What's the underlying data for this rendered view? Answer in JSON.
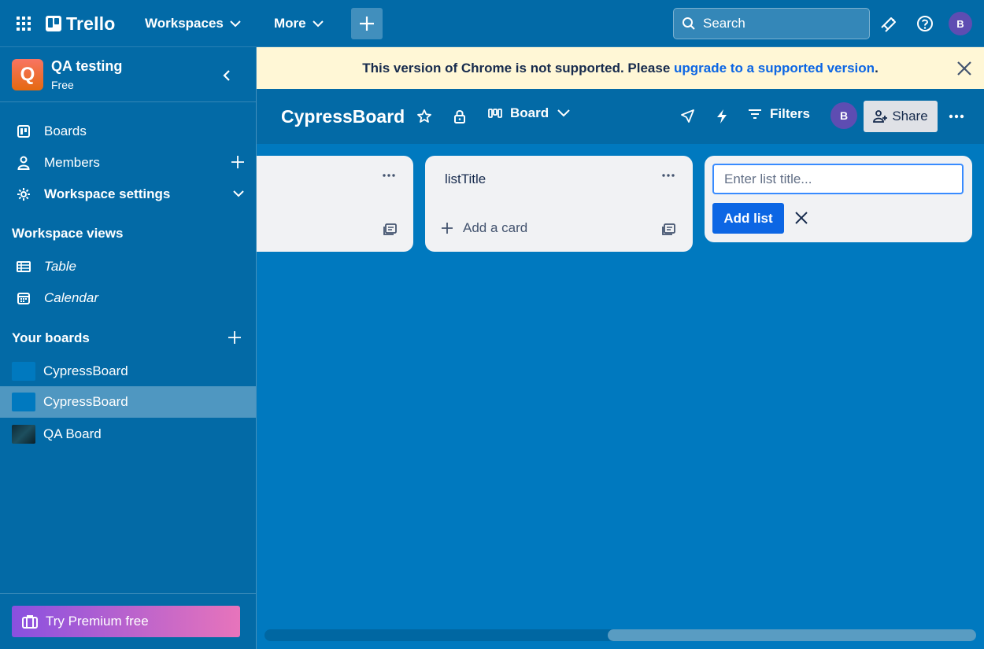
{
  "topbar": {
    "logo_text": "Trello",
    "workspaces_label": "Workspaces",
    "more_label": "More",
    "search_placeholder": "Search",
    "avatar_initial": "B"
  },
  "sidebar": {
    "workspace_initial": "Q",
    "workspace_name": "QA testing",
    "workspace_plan": "Free",
    "items": [
      {
        "label": "Boards",
        "icon": "board-icon"
      },
      {
        "label": "Members",
        "icon": "person-icon"
      },
      {
        "label": "Workspace settings",
        "icon": "gear-icon"
      }
    ],
    "views_heading": "Workspace views",
    "views": [
      {
        "label": "Table",
        "icon": "table-icon"
      },
      {
        "label": "Calendar",
        "icon": "calendar-icon"
      }
    ],
    "boards_heading": "Your boards",
    "boards": [
      {
        "label": "CypressBoard",
        "color": "#0079bf"
      },
      {
        "label": "CypressBoard",
        "color": "#0079bf"
      },
      {
        "label": "QA Board",
        "color": "#1d3f4d"
      }
    ],
    "premium_label": "Try Premium free"
  },
  "banner": {
    "text": "This version of Chrome is not supported. Please ",
    "link": "upgrade to a supported version",
    "end": "."
  },
  "board": {
    "title": "CypressBoard",
    "view_label": "Board",
    "filters_label": "Filters",
    "member_initial": "B",
    "share_label": "Share"
  },
  "lists": [
    {
      "title": ""
    },
    {
      "title": "listTitle",
      "add_card_label": "Add a card"
    }
  ],
  "new_list": {
    "placeholder": "Enter list title...",
    "add_label": "Add list"
  },
  "colors": {
    "board_bg": "#0079bf",
    "header_bg": "#026aa7",
    "primary_button": "#0c66e4",
    "banner_bg": "#fff7d6"
  }
}
